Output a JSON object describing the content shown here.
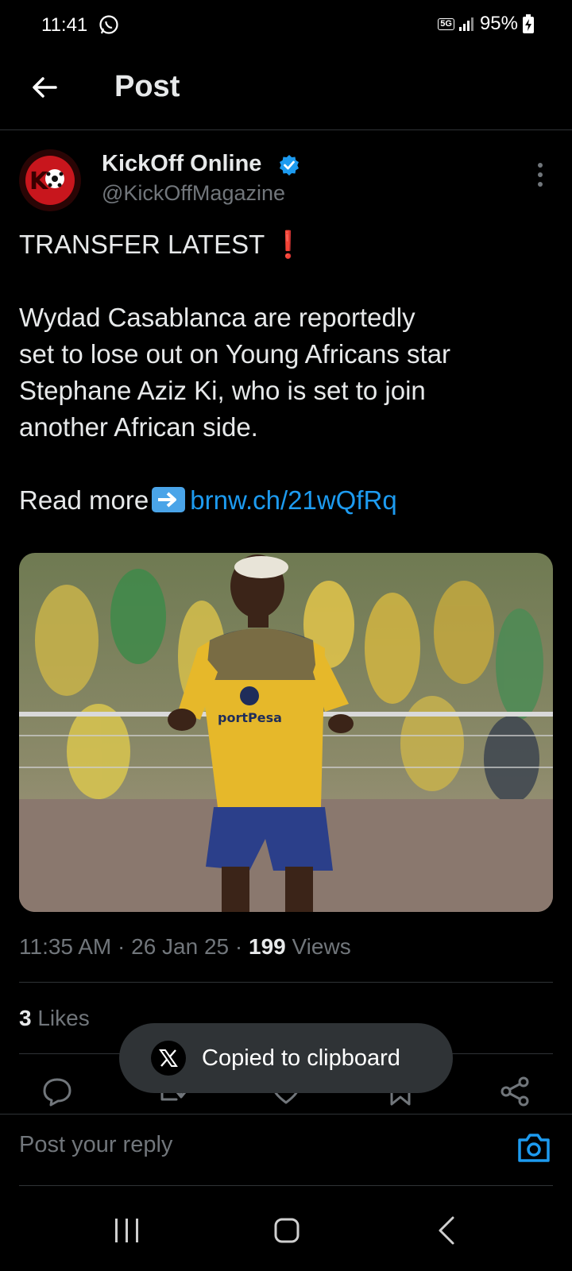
{
  "status_bar": {
    "time": "11:41",
    "network": "5G",
    "battery": "95%"
  },
  "header": {
    "title": "Post"
  },
  "author": {
    "name": "KickOff Online",
    "handle": "@KickOffMagazine",
    "avatar_text": "KO"
  },
  "post": {
    "headline": "TRANSFER LATEST",
    "line1": "Wydad Casablanca are reportedly",
    "line2": "set to lose out on Young Africans star",
    "line3": "Stephane Aziz Ki, who is set to join",
    "line4": "another African side.",
    "read_more": "Read more",
    "link": "brnw.ch/21wQfRq",
    "image_alt": "Young Africans player in yellow and navy kit running on pitch",
    "jersey_sponsor": "portPesa"
  },
  "meta": {
    "time": "11:35 AM",
    "date": "26 Jan 25",
    "views_count": "199",
    "views_label": "Views",
    "sep": "·"
  },
  "likes": {
    "count": "3",
    "label": "Likes"
  },
  "toast": {
    "text": "Copied to clipboard"
  },
  "reply": {
    "placeholder": "Post your reply"
  },
  "colors": {
    "accent": "#1d9bf0",
    "background": "#000000",
    "muted": "#71767b"
  }
}
